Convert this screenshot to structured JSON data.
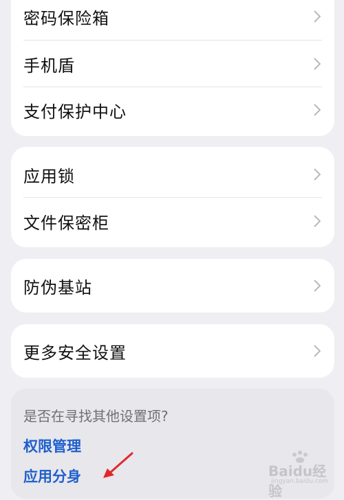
{
  "groups": [
    {
      "items": [
        {
          "label": "密码保险箱"
        },
        {
          "label": "手机盾"
        },
        {
          "label": "支付保护中心"
        }
      ]
    },
    {
      "items": [
        {
          "label": "应用锁"
        },
        {
          "label": "文件保密柜"
        }
      ]
    },
    {
      "items": [
        {
          "label": "防伪基站"
        }
      ]
    },
    {
      "items": [
        {
          "label": "更多安全设置"
        }
      ]
    }
  ],
  "suggestions": {
    "title": "是否在寻找其他设置项?",
    "links": [
      "权限管理",
      "应用分身"
    ]
  },
  "watermark": {
    "text": "Baidu经验",
    "sub": "jingyan.baidu.com"
  },
  "colors": {
    "background": "#efeff3",
    "card": "#ffffff",
    "link": "#1e5fcc",
    "arrow": "#e0282c"
  },
  "icons": {
    "chevron": "chevron-right-icon",
    "arrow": "red-pointer-arrow"
  }
}
